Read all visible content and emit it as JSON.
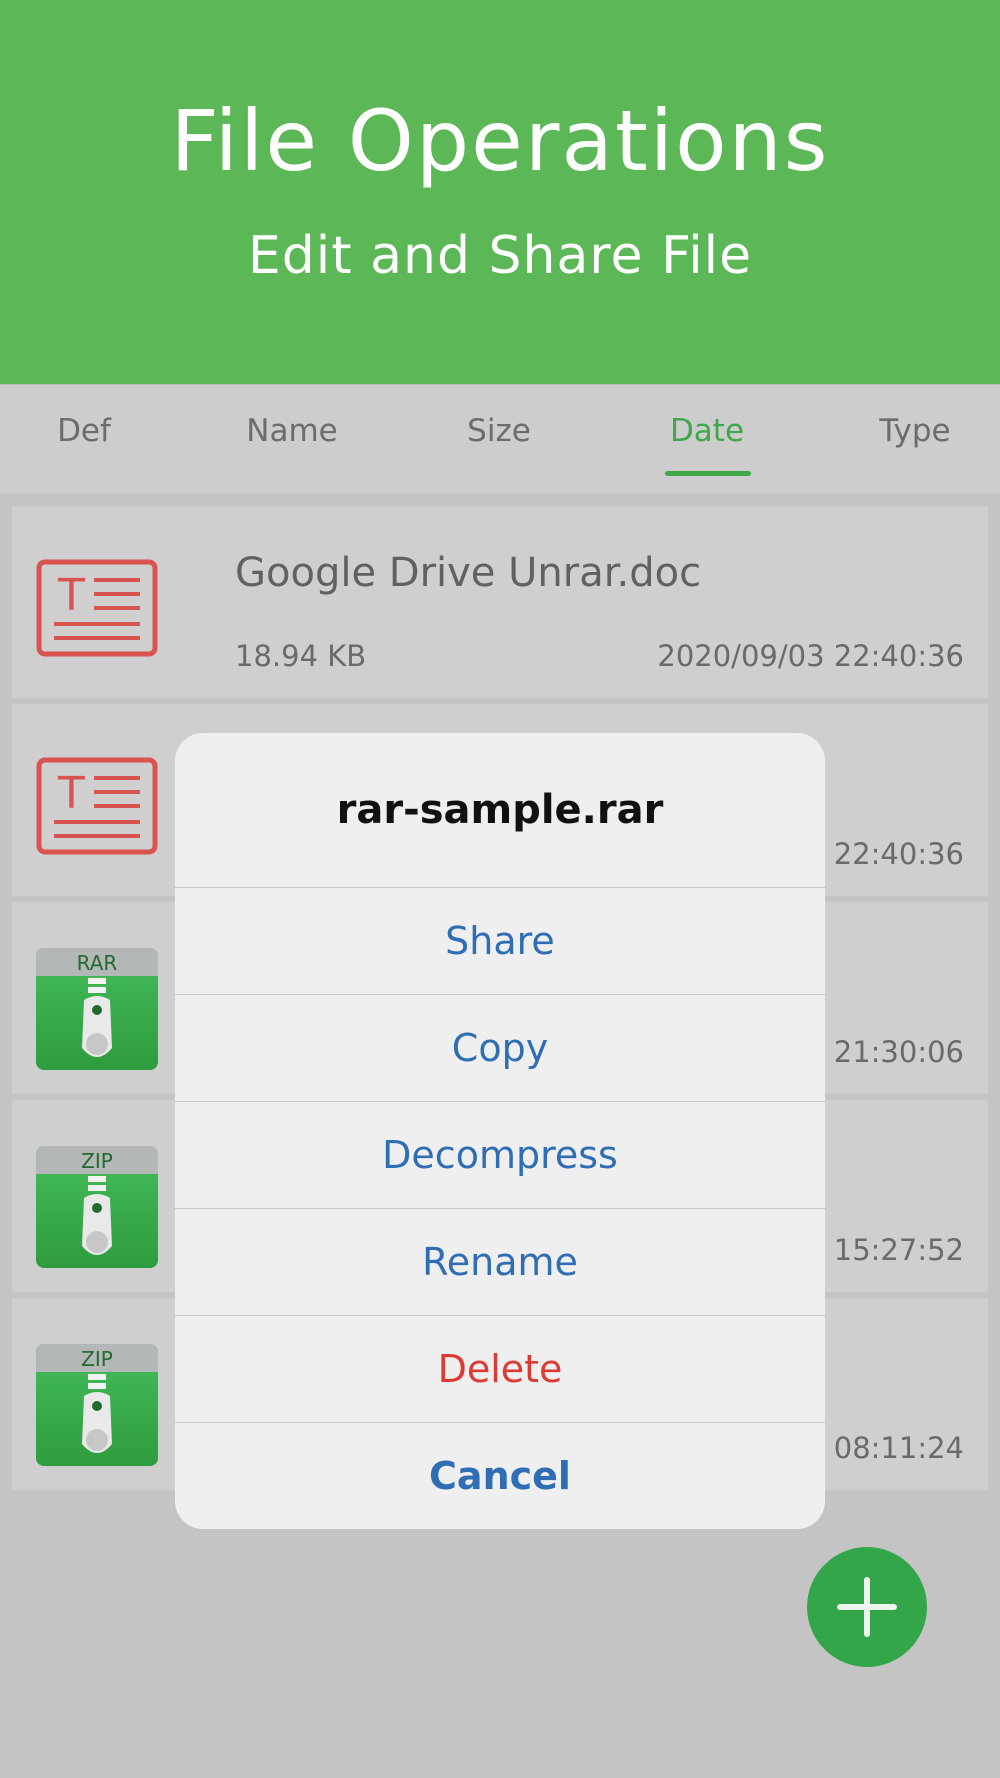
{
  "banner": {
    "title": "File Operations",
    "subtitle": "Edit and Share File"
  },
  "sort_tabs": [
    {
      "label": "Def",
      "active": false
    },
    {
      "label": "Name",
      "active": false
    },
    {
      "label": "Size",
      "active": false
    },
    {
      "label": "Date",
      "active": true
    },
    {
      "label": "Type",
      "active": false
    }
  ],
  "files": [
    {
      "name": "Google Drive Unrar.doc",
      "size": "18.94 KB",
      "date": "2020/09/03 22:40:36",
      "icon": "doc-icon"
    },
    {
      "name": "",
      "size": "",
      "date": "22:40:36",
      "icon": "doc-icon"
    },
    {
      "name": "",
      "size": "",
      "date": "21:30:06",
      "icon": "rar-icon",
      "icon_label": "RAR"
    },
    {
      "name": "",
      "size": "",
      "date": "15:27:52",
      "icon": "zip-icon",
      "icon_label": "ZIP"
    },
    {
      "name": "",
      "size": "",
      "date": "08:11:24",
      "icon": "zip-icon",
      "icon_label": "ZIP"
    }
  ],
  "action_sheet": {
    "title": "rar-sample.rar",
    "actions": [
      "Share",
      "Copy",
      "Decompress",
      "Rename",
      "Delete"
    ],
    "cancel": "Cancel"
  },
  "fab": {
    "icon": "plus-icon"
  },
  "colors": {
    "brand_green": "#5cb857",
    "accent_green": "#3fa94a",
    "action_blue": "#2f6db5",
    "danger_red": "#de3a34",
    "doc_red": "#d9534f"
  }
}
